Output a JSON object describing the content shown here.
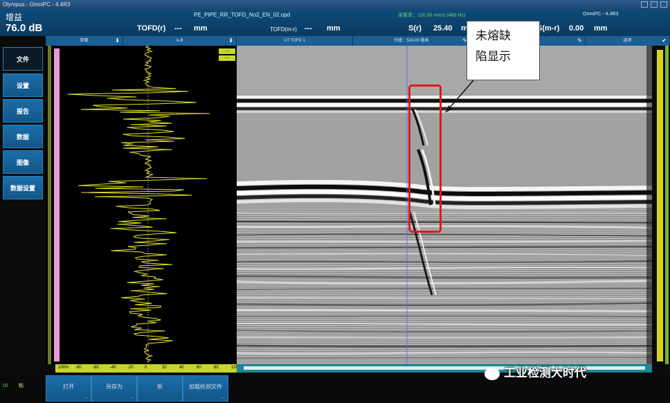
{
  "window": {
    "title": "Olympus - OmniPC - 4.4R3"
  },
  "readout": {
    "gain_label": "增益",
    "gain_value": "76.0 dB",
    "filename": "PE_PIPE_RR_TOFD_No2_EN_02.opd",
    "speed_text": "采集率：120.00 mm/s (480 Hz)",
    "version": "OmniPC - 4.4R3",
    "tofd_r_label": "TOFD(r)",
    "tofd_r_value": "---",
    "tofd_r_unit": "mm",
    "tofd_mr_label": "TOFD(m-r)",
    "tofd_mr_value": "---",
    "tofd_mr_unit": "mm",
    "s_r_label": "S(r)",
    "s_r_value": "25.40",
    "s_r_unit": "m",
    "s_mr_label": "S(m-r)",
    "s_mr_value": "0.00",
    "s_mr_unit": "mm"
  },
  "tabs": [
    {
      "label": "单面",
      "arrow": "⬇"
    },
    {
      "label": "A-B",
      "arrow": "⬇"
    },
    {
      "label": "UT TOFD 1",
      "arrow": ""
    },
    {
      "label": "扫查：524.00 毫米",
      "arrow": "✎"
    },
    {
      "label": "",
      "arrow": "✎"
    },
    {
      "label": "选项",
      "arrow": "✔"
    }
  ],
  "menu": {
    "items": [
      {
        "label": "文件",
        "active": true
      },
      {
        "label": "设置",
        "active": false
      },
      {
        "label": "报告",
        "active": false
      },
      {
        "label": "数据",
        "active": false
      },
      {
        "label": "图像",
        "active": false
      },
      {
        "label": "数据设置",
        "active": false
      }
    ]
  },
  "ascan": {
    "mini_buttons": [
      "---",
      "---"
    ]
  },
  "scale_labels": [
    "100%",
    "-80",
    "-60",
    "-40",
    "-20",
    "0",
    "20",
    "40",
    "60",
    "80",
    "100"
  ],
  "bottom": {
    "buttons": [
      {
        "label": "打开",
        "dots": "..."
      },
      {
        "label": "另存为",
        "dots": "..."
      },
      {
        "label": "新",
        "dots": ""
      },
      {
        "label": "加载检测文件",
        "dots": "..."
      }
    ],
    "status_left": "Ol",
    "status_right": "粘"
  },
  "annotation": {
    "callout_line1": "未熔缺",
    "callout_line2": "陷显示",
    "watermark": "工业检测大时代"
  },
  "colors": {
    "menu_blue": "#1b6ea8",
    "header_blue": "#0e4c7a",
    "ascan_trace": "#e6e62a",
    "highlight_red": "#e01818"
  }
}
